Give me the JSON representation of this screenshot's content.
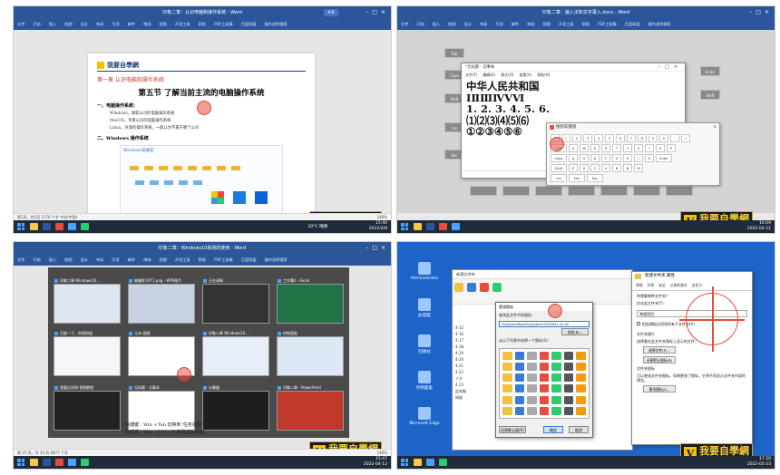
{
  "panel1": {
    "window_title": "印象二章：认识电脑和操作系统 - Word",
    "ribbon_tabs": [
      "文件",
      "开始",
      "插入",
      "绘图",
      "设计",
      "布局",
      "引用",
      "邮件",
      "审阅",
      "视图",
      "开发工具",
      "帮助",
      "PDF工具集",
      "百度网盘",
      "操作说明搜索"
    ],
    "share": "共享",
    "doc_header": "我要自學網",
    "chapter": "第一章 认识电脑和操作系统",
    "section": "第五节 了解当前主流的电脑操作系统",
    "h2_1": "一、电脑操作系统：",
    "bullets": [
      "Windows，微软公司的电脑操作系统",
      "MacOS，苹果公司的电脑操作系统",
      "Linux，开源的操作系统，一般认为不属于哪个公司"
    ],
    "h2_2": "二、Windows 操作系统",
    "diagram_title": "Windows发展史",
    "diagram_sub": "Windows历史版本",
    "status_left": "第1页，共1页  1170 个字  中文(中国)",
    "zoom": "140%",
    "weather": "20°C 晴朗",
    "time": "15:40",
    "date": "2022/4/8"
  },
  "panel2": {
    "window_title": "印象二章：输入法和文字录入.docx - Word",
    "notepad_title": "*无标题 - 记事本",
    "notepad_menu": [
      "文件(F)",
      "编辑(E)",
      "格式(O)",
      "查看(V)",
      "帮助(H)"
    ],
    "lines": [
      "中华人民共和国",
      "ⅠⅡⅢⅣⅤⅥ",
      "1. 2. 3. 4. 5. 6.",
      "⑴⑵⑶⑷⑸⑹",
      "①②③④⑤⑥"
    ],
    "notepad_status": "第2行，第1列    100%   Windows (CRLF)   UTF-8",
    "ime_title": "搜狗软键盘",
    "ime_keys_row1": [
      "~",
      "1",
      "2",
      "3",
      "4",
      "5",
      "6",
      "7",
      "8",
      "9",
      "0",
      "-",
      "="
    ],
    "ime_keys_row2": [
      "Tab",
      "Q",
      "W",
      "E",
      "R",
      "T",
      "Y",
      "U",
      "I",
      "O",
      "P"
    ],
    "ime_keys_row3": [
      "Caps",
      "A",
      "S",
      "D",
      "F",
      "G",
      "H",
      "J",
      "K",
      "Enter"
    ],
    "ime_keys_row4": [
      "Shift",
      "Z",
      "X",
      "C",
      "V",
      "B",
      "N",
      "M"
    ],
    "ime_keys_row5": [
      "Ins",
      "Del",
      "Esc"
    ],
    "keys_left": [
      "Tab",
      "Caps",
      "Shift",
      "Ins",
      "Esc"
    ],
    "keys_right": [
      "Enter",
      "Shift",
      "Esc",
      "Esc"
    ],
    "time": "16:09",
    "date": "2022-04-21"
  },
  "panel3": {
    "window_title": "印象二章：Windows10系统的使用 - Word",
    "thumbs": [
      "印象二章 Windows10...",
      "被删除 DIT1.png - WPS图片",
      "正在录制",
      "百度一下，你就知道",
      "元本-画图",
      "印象二章 Windows10...",
      "控制面板",
      "我要自学网-视频教程",
      "无标题 - 记事本",
      "计算器",
      "印象二章 - PowerPoint",
      "工作簿1 - Excel"
    ],
    "tip1": "（快捷键：Win +Tab 切换到“任务视图”）",
    "tip2": "（快捷键：Win +Ctrl +D 新建虚拟桌面）",
    "status_left": "第 25 页，共 34 页  6877 个字",
    "zoom": "140%",
    "time": "15:47",
    "date": "2022-04-12"
  },
  "panel4": {
    "desktop_icons": [
      "Administrator",
      "此电脑",
      "回收站",
      "控制面板",
      "Microsoft Edge"
    ],
    "explorer_title": "新建文件夹",
    "icon_dialog_title": "更改图标",
    "icon_dialog_label": "查找此文件中的图标:",
    "icon_dialog_path": "%SystemRoot%\\System32\\SHELL32.dll",
    "browse": "浏览(B)...",
    "icon_dialog_list_label": "从以下列表中选择一个图标(S):",
    "restore_default": "还原默认值(R)",
    "ok": "确定",
    "cancel": "取消",
    "side_items": [
      "4-15",
      "4-16",
      "4-17",
      "4-18",
      "4-19",
      "4-20",
      "4-21",
      "4-22",
      "十大",
      "4-23",
      "此电脑",
      "网络"
    ],
    "props_title": "新建文件夹 属性",
    "props_tabs": [
      "常规",
      "共享",
      "安全",
      "以前的版本",
      "自定义"
    ],
    "props_q1": "你想要哪种文件夹?",
    "props_q1b": "优化此文件夹(T):",
    "props_opt": "常规项目",
    "props_chk": "把此模板应用到所有子文件夹(A)",
    "props_pics": "文件夹图片",
    "props_pics_desc": "选择要在此文件夹图标上显示的文件。",
    "choose_file": "选择文件(F)...",
    "restore": "还原默认图标(R)",
    "props_icon_head": "文件夹图标",
    "props_icon_desc": "可以更改文件夹图标。如果更改了图标，它将不再显示文件夹内容的预览。",
    "change_icon": "更改图标(I)...",
    "time": "17:20",
    "date": "2022-05-23"
  },
  "watermark": {
    "main": "我要自學網",
    "sub": "www.51zxw.net"
  },
  "colors": {
    "word_blue": "#2b579a",
    "desktop_blue": "#1e63c8",
    "cursor": "#e74c3c"
  }
}
